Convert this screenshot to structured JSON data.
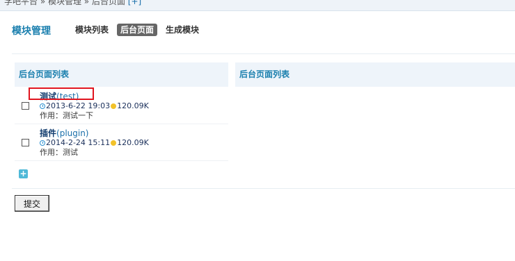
{
  "breadcrumb": {
    "path": "学吧平台 » 模块管理 » 后台页面",
    "add_link": "[+]"
  },
  "module": {
    "title": "模块管理",
    "tabs": [
      {
        "label": "模块列表",
        "active": false
      },
      {
        "label": "后台页面",
        "active": true
      },
      {
        "label": "生成模块",
        "active": false
      }
    ]
  },
  "panels": {
    "left_title": "后台页面列表",
    "right_title": "后台页面列表"
  },
  "items": [
    {
      "name": "测试",
      "code": "(test)",
      "date": "2013-6-22 19:03",
      "size": "120.09K",
      "desc": "作用：测试一下",
      "checked": false
    },
    {
      "name": "插件",
      "code": "(plugin)",
      "date": "2014-2-24 15:11",
      "size": "120.09K",
      "desc": "作用：测试",
      "checked": false
    }
  ],
  "add_symbol": "+",
  "submit_label": "提交",
  "colors": {
    "accent": "#1a7fae",
    "highlight_box": "#e0141e",
    "active_tab_bg": "#666666",
    "panel_header_bg": "#eef4fa"
  }
}
